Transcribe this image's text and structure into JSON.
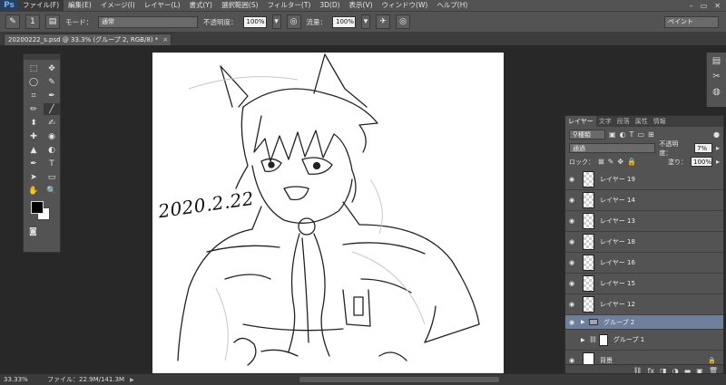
{
  "menubar": {
    "logo": "Ps",
    "items": [
      "ファイル(F)",
      "編集(E)",
      "イメージ(I)",
      "レイヤー(L)",
      "書式(Y)",
      "選択範囲(S)",
      "フィルター(T)",
      "3D(D)",
      "表示(V)",
      "ウィンドウ(W)",
      "ヘルプ(H)"
    ],
    "window_controls": [
      "–",
      "▭",
      "✕"
    ]
  },
  "options": {
    "brush_size": "1",
    "mode_label": "モード：",
    "mode_value": "通常",
    "opacity_label": "不透明度：",
    "opacity_value": "100%",
    "flow_label": "流量：",
    "flow_value": "100%",
    "workspace": "ペイント"
  },
  "document": {
    "tab_title": "20200222_s.psd @ 33.3% (グループ 2, RGB/8) *",
    "close": "×",
    "canvas_text": "2020.2.22"
  },
  "toolbox": {
    "tools": [
      "⬚",
      "✥",
      "◯",
      "✎",
      "⌗",
      "✒",
      "✏",
      "╱",
      "⬍",
      "✍",
      "✚",
      "◉",
      "▲",
      "◐",
      "✒",
      "T",
      "➤",
      "▭",
      "✋",
      "🔍"
    ]
  },
  "layers_panel": {
    "tabs": [
      "レイヤー",
      "文字",
      "段落",
      "属性",
      "情報"
    ],
    "filter_label": "種類",
    "blend_mode": "通過",
    "opacity_label": "不透明度：",
    "opacity_value": "7%",
    "lock_label": "ロック：",
    "fill_label": "塗り：",
    "fill_value": "100%",
    "layers": [
      {
        "name": "レイヤー 19",
        "visible": true,
        "kind": "layer"
      },
      {
        "name": "レイヤー 14",
        "visible": true,
        "kind": "layer"
      },
      {
        "name": "レイヤー 13",
        "visible": true,
        "kind": "layer"
      },
      {
        "name": "レイヤー 18",
        "visible": true,
        "kind": "layer"
      },
      {
        "name": "レイヤー 16",
        "visible": true,
        "kind": "layer"
      },
      {
        "name": "レイヤー 15",
        "visible": true,
        "kind": "layer"
      },
      {
        "name": "レイヤー 12",
        "visible": true,
        "kind": "layer"
      },
      {
        "name": "グループ 2",
        "visible": true,
        "kind": "group-selected"
      },
      {
        "name": "グループ 1",
        "visible": false,
        "kind": "group-masked"
      },
      {
        "name": "背景",
        "visible": true,
        "kind": "background"
      }
    ],
    "footer_icons": [
      "⛓",
      "fx",
      "◨",
      "◑",
      "▬",
      "▣",
      "🗑"
    ]
  },
  "status": {
    "zoom": "33.33%",
    "file_info": "ファイル：22.9M/141.3M"
  },
  "colors": {
    "selected_layer": "#6e7f9c",
    "panel_bg": "#535353"
  }
}
